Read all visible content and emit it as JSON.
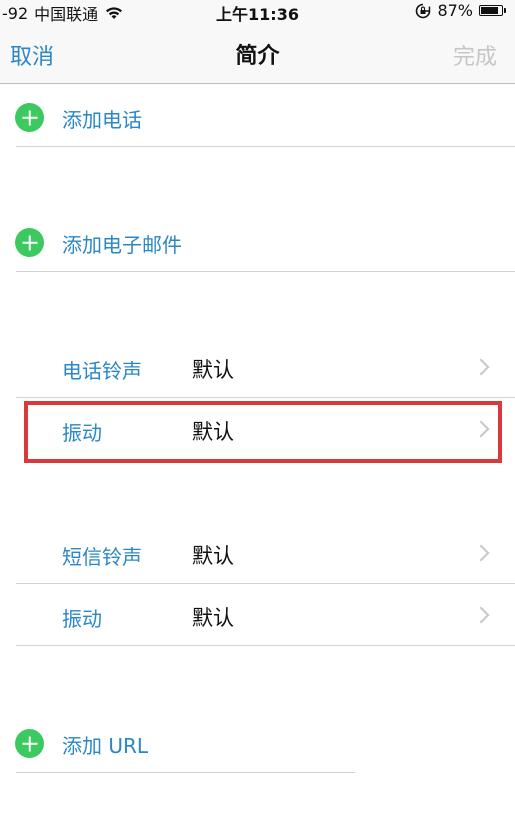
{
  "status_bar": {
    "signal": "-92",
    "carrier": "中国联通",
    "time": "上午11:36",
    "battery": "87%",
    "battery_level": 0.87
  },
  "nav": {
    "cancel_label": "取消",
    "title": "简介",
    "done_label": "完成"
  },
  "rows": {
    "add_phone": "添加电话",
    "add_email": "添加电子邮件",
    "ringtone_label": "电话铃声",
    "ringtone_value": "默认",
    "ringtone_vibration_label": "振动",
    "ringtone_vibration_value": "默认",
    "text_tone_label": "短信铃声",
    "text_tone_value": "默认",
    "text_vibration_label": "振动",
    "text_vibration_value": "默认",
    "add_url": "添加 URL"
  },
  "colors": {
    "accent": "#2a87c8",
    "add_green": "#3cc960",
    "highlight_red": "#d9393c",
    "disabled": "#c6c6c6"
  },
  "icons": [
    "wifi-icon",
    "rotation-lock-icon",
    "battery-icon",
    "add-icon",
    "chevron-right-icon"
  ]
}
